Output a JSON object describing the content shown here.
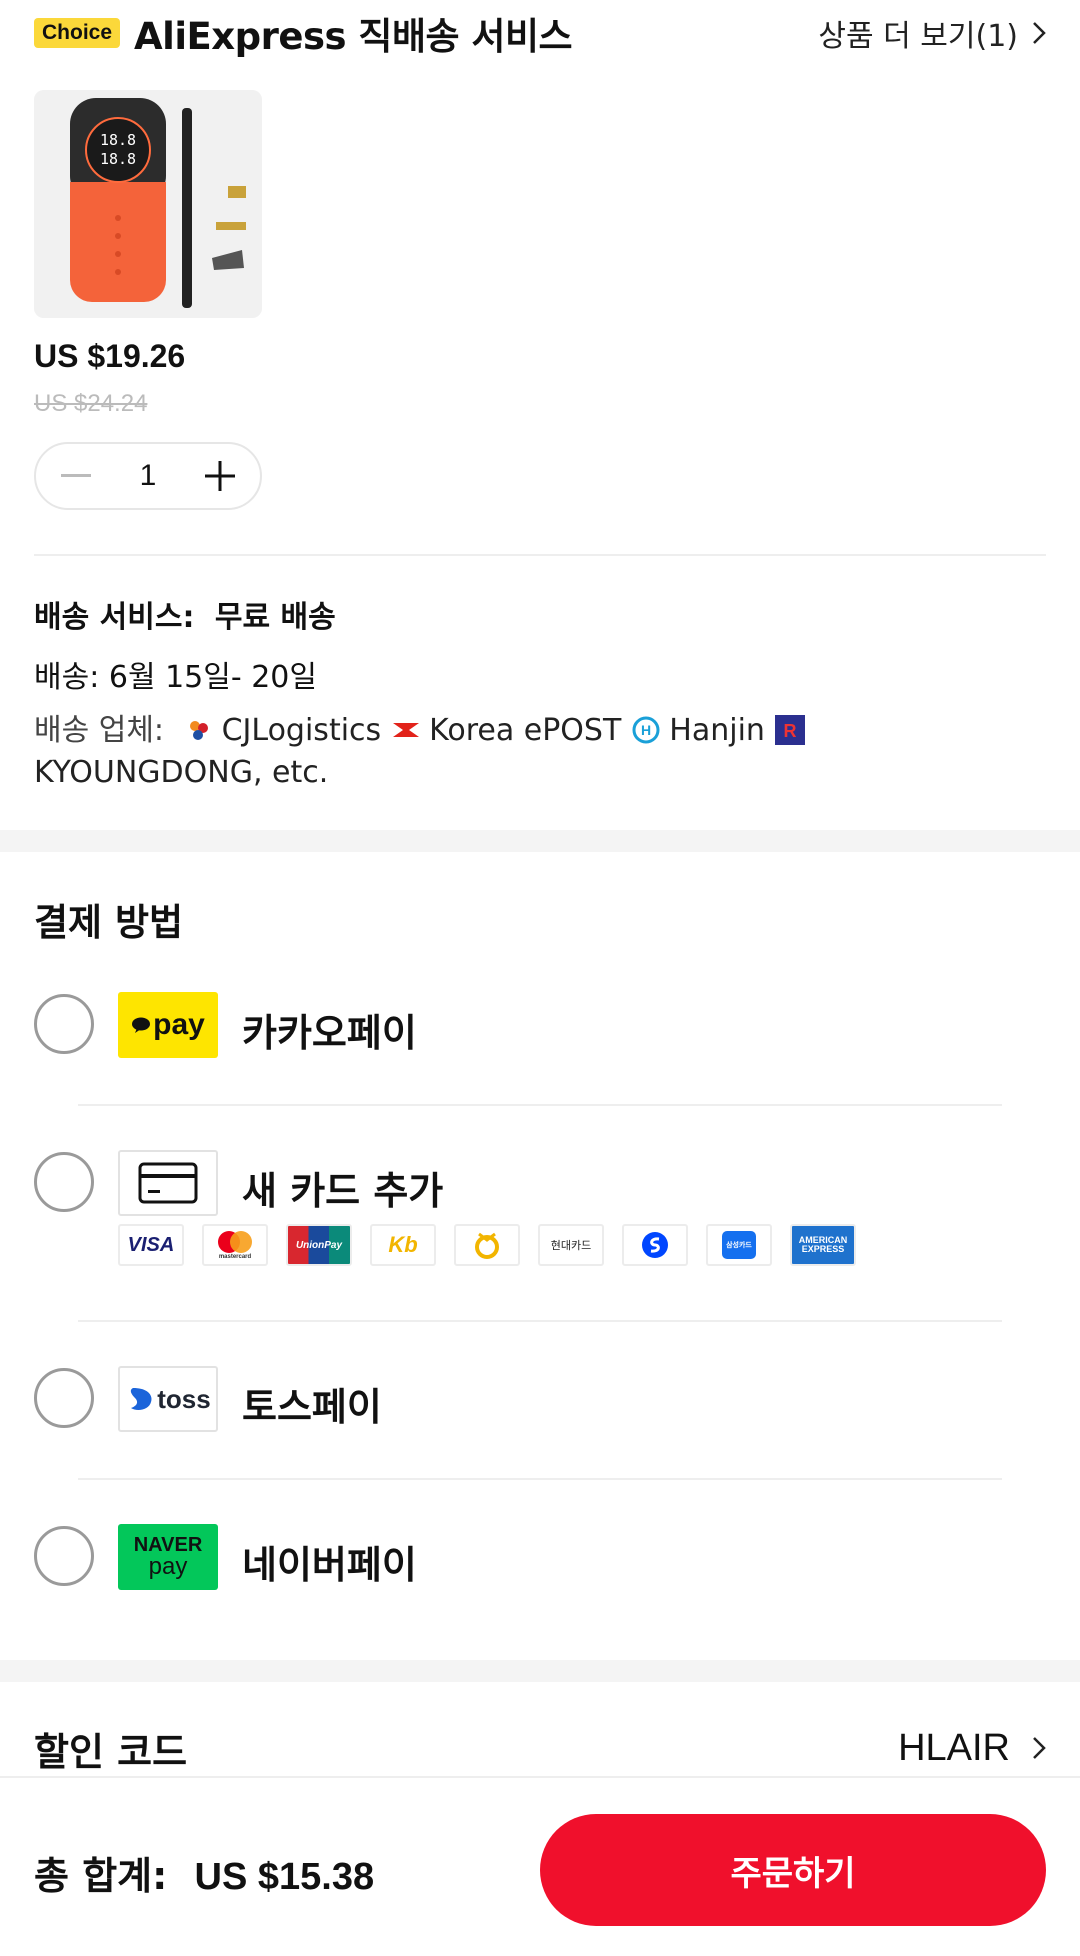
{
  "header": {
    "badge": "Choice",
    "title": "AliExpress 직배송 서비스",
    "more_link": "상품 더 보기(1)"
  },
  "product": {
    "price": "US $19.26",
    "original_price": "US $24.24",
    "quantity": "1"
  },
  "shipping": {
    "service_label": "배송 서비스:",
    "service_value": "무료 배송",
    "date_label": "배송:",
    "date_value": "6월 15일- 20일",
    "carriers_label": "배송 업체:",
    "carriers": [
      "CJLogistics",
      "Korea ePOST",
      "Hanjin",
      "KYOUNGDONG, etc."
    ]
  },
  "payment": {
    "title": "결제 방법",
    "methods": [
      {
        "name": "카카오페이",
        "logo": "kakao-pay",
        "logo_text": "pay"
      },
      {
        "name": "새 카드 추가",
        "logo": "card"
      },
      {
        "name": "토스페이",
        "logo": "toss",
        "logo_text": "toss"
      },
      {
        "name": "네이버페이",
        "logo": "naver-pay",
        "logo_line1": "NAVER",
        "logo_line2": "pay"
      }
    ],
    "card_brands": [
      {
        "name": "visa",
        "text": "VISA"
      },
      {
        "name": "mastercard",
        "text": "mastercard"
      },
      {
        "name": "unionpay",
        "text": "UnionPay"
      },
      {
        "name": "kb",
        "text": "Kb"
      },
      {
        "name": "nh",
        "text": ""
      },
      {
        "name": "hyundai",
        "text": "현대카드"
      },
      {
        "name": "shinhan",
        "text": ""
      },
      {
        "name": "samsung",
        "text": "삼성카드"
      },
      {
        "name": "amex",
        "text": "AMERICAN EXPRESS"
      }
    ]
  },
  "discount": {
    "label": "할인 코드",
    "code": "HLAIR"
  },
  "footer": {
    "total_label": "총 합계:",
    "total_value": "US $15.38",
    "order_button": "주문하기"
  },
  "colors": {
    "accent": "#f0102c",
    "choice_badge": "#fbd83a",
    "kakao": "#fee500",
    "naver": "#03c75a"
  }
}
